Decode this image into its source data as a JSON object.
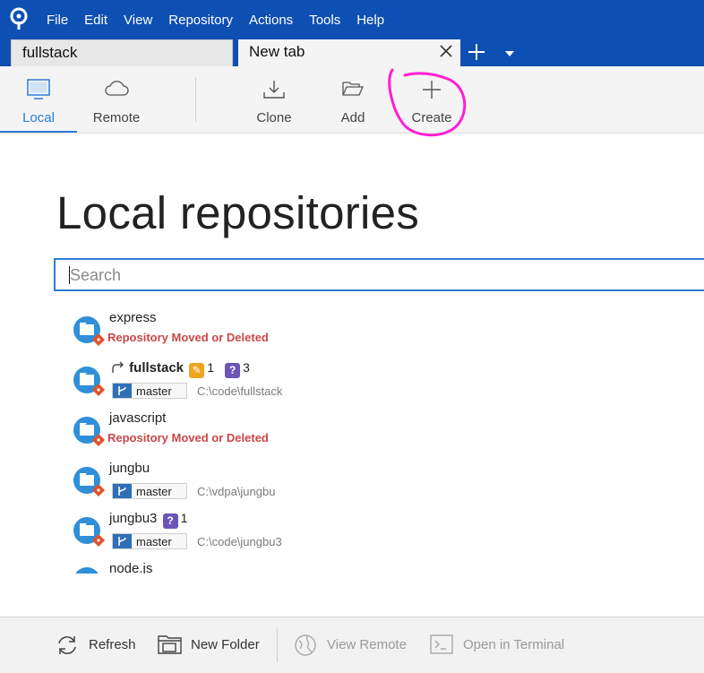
{
  "app": {
    "menu": [
      "File",
      "Edit",
      "View",
      "Repository",
      "Actions",
      "Tools",
      "Help"
    ]
  },
  "tabs": {
    "items": [
      {
        "label": "fullstack",
        "active": false
      },
      {
        "label": "New tab",
        "active": true
      }
    ],
    "close_icon": "close-icon",
    "add_icon": "plus-icon",
    "dropdown_icon": "chevron-down-icon"
  },
  "toolbar": {
    "local_label": "Local",
    "remote_label": "Remote",
    "clone_label": "Clone",
    "add_label": "Add",
    "create_label": "Create"
  },
  "main": {
    "heading": "Local repositories",
    "search_placeholder": "Search",
    "repos": [
      {
        "name": "express",
        "status": "Repository Moved or Deleted"
      },
      {
        "name": "fullstack",
        "modified_count": "1",
        "untracked_count": "3",
        "branch": "master",
        "path": "C:\\code\\fullstack"
      },
      {
        "name": "javascript",
        "status": "Repository Moved or Deleted"
      },
      {
        "name": "jungbu",
        "branch": "master",
        "path": "C:\\vdpa\\jungbu"
      },
      {
        "name": "jungbu3",
        "untracked_count": "1",
        "branch": "master",
        "path": "C:\\code\\jungbu3"
      },
      {
        "name": "node.js"
      }
    ]
  },
  "bottombar": {
    "refresh_label": "Refresh",
    "new_folder_label": "New Folder",
    "view_remote_label": "View Remote",
    "open_terminal_label": "Open in Terminal"
  },
  "colors": {
    "menubar": "#0e4fb3",
    "accent": "#2c7cd6",
    "error": "#c9474a",
    "annotation": "#ff1fd4"
  }
}
